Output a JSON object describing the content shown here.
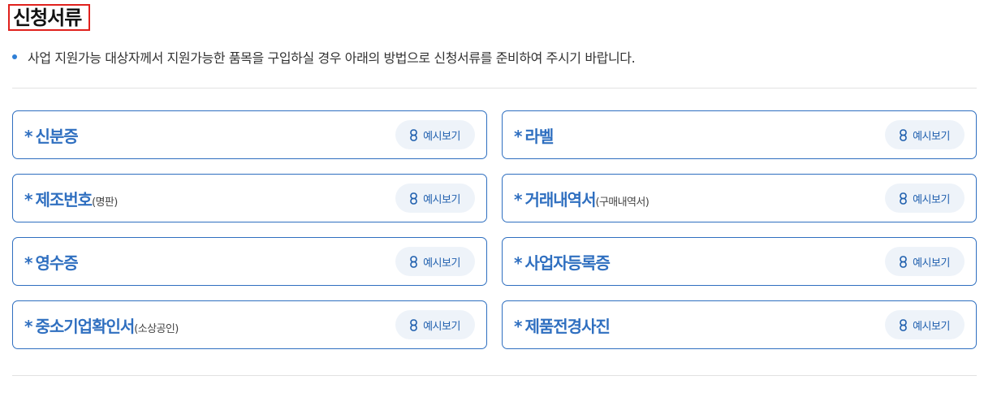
{
  "section": {
    "title": "신청서류",
    "description": "사업 지원가능 대상자께서 지원가능한 품목을 구입하실 경우 아래의 방법으로 신청서류를 준비하여 주시기 바랍니다."
  },
  "documents": [
    {
      "star": "*",
      "title": "신분증",
      "sub": "",
      "button": "예시보기"
    },
    {
      "star": "*",
      "title": "라벨",
      "sub": "",
      "button": "예시보기"
    },
    {
      "star": "*",
      "title": "제조번호",
      "sub": "(명판)",
      "button": "예시보기"
    },
    {
      "star": "*",
      "title": "거래내역서",
      "sub": "(구매내역서)",
      "button": "예시보기"
    },
    {
      "star": "*",
      "title": "영수증",
      "sub": "",
      "button": "예시보기"
    },
    {
      "star": "*",
      "title": "사업자등록증",
      "sub": "",
      "button": "예시보기"
    },
    {
      "star": "*",
      "title": "중소기업확인서",
      "sub": "(소상공인)",
      "button": "예시보기"
    },
    {
      "star": "*",
      "title": "제품전경사진",
      "sub": "",
      "button": "예시보기"
    }
  ],
  "colors": {
    "accent": "#2f6fc0",
    "title_highlight_border": "#e0211d",
    "button_bg": "#eef3f9"
  },
  "icons": {
    "example_button_icon": "link-icon"
  }
}
